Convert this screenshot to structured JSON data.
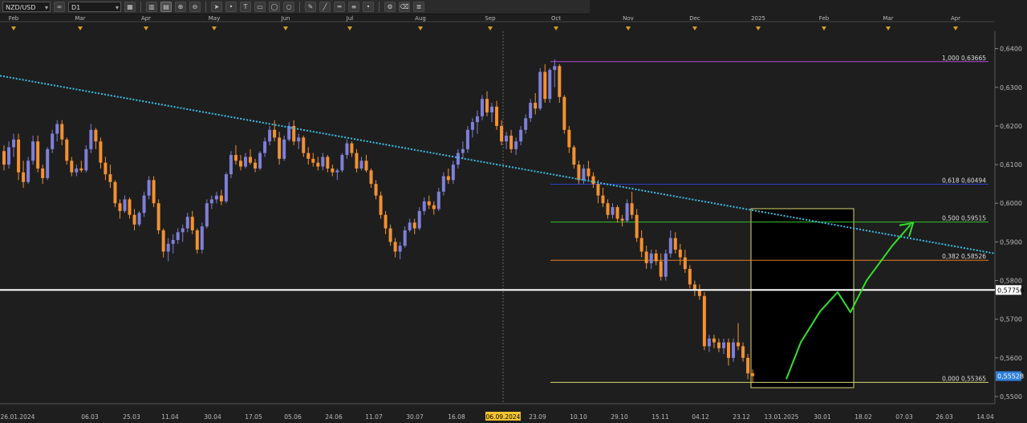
{
  "toolbar": {
    "symbol": "NZD/USD",
    "link": "∞",
    "timeframe": "D1",
    "buttons": [
      "chart-type-icon",
      "bar-chart-icon",
      "candle-chart-icon",
      "zoom-in-icon",
      "zoom-out-icon",
      "cursor-icon",
      "dot-icon",
      "text-icon",
      "rectangle-icon",
      "ellipse-icon",
      "circle-icon",
      "pencil-icon",
      "line-icon",
      "channel-icon",
      "fibonacci-icon",
      "dot-tool-icon",
      "gear-icon",
      "eraser-icon",
      "layers-icon"
    ]
  },
  "colors": {
    "bg": "#1e1e1e",
    "bull": "#7f7fd9",
    "bear": "#f39131",
    "trend": "#3cc0e8",
    "box": "#d8d870",
    "green_path": "#33e02a"
  },
  "chart_data": {
    "type": "candlestick",
    "symbol": "NZD/USD",
    "timeframe": "D1",
    "ylim": [
      0.55,
      0.642
    ],
    "y_ticks": [
      "0,6400",
      "0,6300",
      "0,6200",
      "0,6100",
      "0,6000",
      "0,5900",
      "0,5800",
      "0,5700",
      "0,5600",
      "0,5500"
    ],
    "month_labels": [
      "Feb",
      "Mar",
      "Apr",
      "May",
      "Jun",
      "Jul",
      "Aug",
      "Sep",
      "Oct",
      "Nov",
      "Dec",
      "2025",
      "Feb",
      "Mar",
      "Apr"
    ],
    "date_labels": [
      "26.01.2024",
      "06.03",
      "25.03",
      "11.04",
      "30.04",
      "17.05",
      "05.06",
      "24.06",
      "11.07",
      "30.07",
      "16.08",
      "06.09.2024",
      "23.09",
      "10.10",
      "29.10",
      "15.11",
      "04.12",
      "23.12",
      "13.01.2025",
      "30.01",
      "18.02",
      "07.03",
      "26.03",
      "14.04"
    ],
    "highlighted_date": "06.09.2024",
    "fibonacci": [
      {
        "label": "1,000 0,63665",
        "value": 0.63665,
        "color": "#b04ad8"
      },
      {
        "label": "0,618 0,60494",
        "value": 0.60494,
        "color": "#2d3fc8"
      },
      {
        "label": "0,500 0,59515",
        "value": 0.59515,
        "color": "#36c02e"
      },
      {
        "label": "0,382 0,58526",
        "value": 0.58526,
        "color": "#e07c26"
      },
      {
        "label": "0,000 0,55365",
        "value": 0.55365,
        "color": "#d8d870"
      }
    ],
    "horizontal_level": {
      "label": "0,57756",
      "value": 0.57756
    },
    "current_price": {
      "label": "0,55528",
      "value": 0.55528
    },
    "trendline": {
      "from": 0.633,
      "to": 0.587
    },
    "projection": [
      0.5545,
      0.564,
      0.572,
      0.577,
      0.5718,
      0.58,
      0.589,
      0.5945
    ],
    "candles": [
      [
        0.6135,
        0.615,
        0.6085,
        0.61
      ],
      [
        0.61,
        0.616,
        0.609,
        0.6145
      ],
      [
        0.6145,
        0.618,
        0.612,
        0.6165
      ],
      [
        0.6165,
        0.618,
        0.606,
        0.608
      ],
      [
        0.608,
        0.611,
        0.604,
        0.6055
      ],
      [
        0.6055,
        0.612,
        0.605,
        0.611
      ],
      [
        0.611,
        0.6175,
        0.61,
        0.616
      ],
      [
        0.616,
        0.6175,
        0.608,
        0.609
      ],
      [
        0.609,
        0.61,
        0.605,
        0.6065
      ],
      [
        0.6065,
        0.6145,
        0.606,
        0.614
      ],
      [
        0.614,
        0.619,
        0.613,
        0.618
      ],
      [
        0.618,
        0.6215,
        0.616,
        0.6205
      ],
      [
        0.6205,
        0.6215,
        0.615,
        0.6165
      ],
      [
        0.6165,
        0.617,
        0.61,
        0.611
      ],
      [
        0.611,
        0.612,
        0.607,
        0.608
      ],
      [
        0.608,
        0.61,
        0.607,
        0.609
      ],
      [
        0.609,
        0.611,
        0.608,
        0.6085
      ],
      [
        0.6085,
        0.615,
        0.608,
        0.614
      ],
      [
        0.614,
        0.6205,
        0.613,
        0.619
      ],
      [
        0.619,
        0.6195,
        0.614,
        0.616
      ],
      [
        0.616,
        0.617,
        0.609,
        0.6105
      ],
      [
        0.6105,
        0.612,
        0.606,
        0.6075
      ],
      [
        0.6075,
        0.61,
        0.604,
        0.6055
      ],
      [
        0.6055,
        0.606,
        0.599,
        0.6
      ],
      [
        0.6,
        0.601,
        0.596,
        0.598
      ],
      [
        0.598,
        0.602,
        0.5975,
        0.601
      ],
      [
        0.601,
        0.6015,
        0.596,
        0.597
      ],
      [
        0.597,
        0.5985,
        0.593,
        0.5945
      ],
      [
        0.5945,
        0.598,
        0.594,
        0.5975
      ],
      [
        0.5975,
        0.603,
        0.5965,
        0.602
      ],
      [
        0.602,
        0.607,
        0.601,
        0.606
      ],
      [
        0.606,
        0.607,
        0.599,
        0.6
      ],
      [
        0.6,
        0.601,
        0.592,
        0.593
      ],
      [
        0.593,
        0.5935,
        0.586,
        0.5875
      ],
      [
        0.5875,
        0.591,
        0.585,
        0.5895
      ],
      [
        0.5895,
        0.592,
        0.587,
        0.5905
      ],
      [
        0.5905,
        0.5935,
        0.5895,
        0.5925
      ],
      [
        0.5925,
        0.5945,
        0.59,
        0.5935
      ],
      [
        0.5935,
        0.5975,
        0.5925,
        0.5965
      ],
      [
        0.5965,
        0.598,
        0.592,
        0.593
      ],
      [
        0.593,
        0.5935,
        0.587,
        0.588
      ],
      [
        0.588,
        0.595,
        0.587,
        0.594
      ],
      [
        0.594,
        0.601,
        0.5935,
        0.6
      ],
      [
        0.6,
        0.602,
        0.5985,
        0.601
      ],
      [
        0.601,
        0.603,
        0.6,
        0.602
      ],
      [
        0.602,
        0.6035,
        0.5995,
        0.6005
      ],
      [
        0.6005,
        0.608,
        0.6,
        0.6075
      ],
      [
        0.6075,
        0.6135,
        0.6065,
        0.6125
      ],
      [
        0.6125,
        0.615,
        0.61,
        0.611
      ],
      [
        0.611,
        0.6125,
        0.6085,
        0.6095
      ],
      [
        0.6095,
        0.613,
        0.609,
        0.612
      ],
      [
        0.612,
        0.614,
        0.61,
        0.6105
      ],
      [
        0.6105,
        0.6115,
        0.608,
        0.609
      ],
      [
        0.609,
        0.6135,
        0.6085,
        0.613
      ],
      [
        0.613,
        0.617,
        0.612,
        0.616
      ],
      [
        0.616,
        0.62,
        0.615,
        0.619
      ],
      [
        0.619,
        0.6215,
        0.616,
        0.617
      ],
      [
        0.617,
        0.6185,
        0.61,
        0.6115
      ],
      [
        0.6115,
        0.6175,
        0.611,
        0.6165
      ],
      [
        0.6165,
        0.621,
        0.616,
        0.62
      ],
      [
        0.62,
        0.6215,
        0.615,
        0.616
      ],
      [
        0.616,
        0.618,
        0.614,
        0.617
      ],
      [
        0.617,
        0.6175,
        0.612,
        0.613
      ],
      [
        0.613,
        0.6145,
        0.61,
        0.6115
      ],
      [
        0.6115,
        0.613,
        0.6095,
        0.6105
      ],
      [
        0.6105,
        0.612,
        0.6085,
        0.6095
      ],
      [
        0.6095,
        0.613,
        0.6085,
        0.612
      ],
      [
        0.612,
        0.6125,
        0.608,
        0.609
      ],
      [
        0.609,
        0.61,
        0.607,
        0.608
      ],
      [
        0.608,
        0.609,
        0.606,
        0.6085
      ],
      [
        0.6085,
        0.613,
        0.608,
        0.6125
      ],
      [
        0.6125,
        0.6165,
        0.6115,
        0.6155
      ],
      [
        0.6155,
        0.616,
        0.612,
        0.613
      ],
      [
        0.613,
        0.614,
        0.608,
        0.609
      ],
      [
        0.609,
        0.612,
        0.6085,
        0.611
      ],
      [
        0.611,
        0.6125,
        0.608,
        0.6085
      ],
      [
        0.6085,
        0.609,
        0.604,
        0.605
      ],
      [
        0.605,
        0.606,
        0.601,
        0.602
      ],
      [
        0.602,
        0.603,
        0.596,
        0.597
      ],
      [
        0.597,
        0.598,
        0.592,
        0.5935
      ],
      [
        0.5935,
        0.5945,
        0.589,
        0.59
      ],
      [
        0.59,
        0.591,
        0.586,
        0.5875
      ],
      [
        0.5875,
        0.59,
        0.5855,
        0.589
      ],
      [
        0.589,
        0.594,
        0.5885,
        0.593
      ],
      [
        0.593,
        0.596,
        0.5925,
        0.595
      ],
      [
        0.595,
        0.596,
        0.592,
        0.5935
      ],
      [
        0.5935,
        0.599,
        0.593,
        0.598
      ],
      [
        0.598,
        0.6015,
        0.597,
        0.6005
      ],
      [
        0.6005,
        0.602,
        0.5985,
        0.5995
      ],
      [
        0.5995,
        0.6005,
        0.597,
        0.5985
      ],
      [
        0.5985,
        0.604,
        0.598,
        0.603
      ],
      [
        0.603,
        0.608,
        0.602,
        0.607
      ],
      [
        0.607,
        0.609,
        0.605,
        0.606
      ],
      [
        0.606,
        0.611,
        0.605,
        0.61
      ],
      [
        0.61,
        0.614,
        0.609,
        0.613
      ],
      [
        0.613,
        0.616,
        0.6115,
        0.614
      ],
      [
        0.614,
        0.62,
        0.613,
        0.619
      ],
      [
        0.619,
        0.622,
        0.617,
        0.621
      ],
      [
        0.621,
        0.624,
        0.618,
        0.6225
      ],
      [
        0.6225,
        0.628,
        0.6215,
        0.627
      ],
      [
        0.627,
        0.629,
        0.6225,
        0.6235
      ],
      [
        0.6235,
        0.626,
        0.621,
        0.625
      ],
      [
        0.625,
        0.6265,
        0.619,
        0.62
      ],
      [
        0.62,
        0.6215,
        0.615,
        0.616
      ],
      [
        0.616,
        0.6185,
        0.614,
        0.6175
      ],
      [
        0.6175,
        0.619,
        0.613,
        0.614
      ],
      [
        0.614,
        0.617,
        0.6125,
        0.616
      ],
      [
        0.616,
        0.62,
        0.615,
        0.619
      ],
      [
        0.619,
        0.623,
        0.618,
        0.622
      ],
      [
        0.622,
        0.627,
        0.621,
        0.626
      ],
      [
        0.626,
        0.6285,
        0.623,
        0.6245
      ],
      [
        0.6245,
        0.635,
        0.624,
        0.634
      ],
      [
        0.634,
        0.636,
        0.626,
        0.627
      ],
      [
        0.627,
        0.635,
        0.626,
        0.6345
      ],
      [
        0.6345,
        0.6372,
        0.63,
        0.6355
      ],
      [
        0.6355,
        0.636,
        0.626,
        0.6275
      ],
      [
        0.6275,
        0.628,
        0.618,
        0.619
      ],
      [
        0.619,
        0.62,
        0.613,
        0.6145
      ],
      [
        0.6145,
        0.615,
        0.609,
        0.61
      ],
      [
        0.61,
        0.611,
        0.605,
        0.606
      ],
      [
        0.606,
        0.61,
        0.605,
        0.609
      ],
      [
        0.609,
        0.611,
        0.606,
        0.607
      ],
      [
        0.607,
        0.608,
        0.604,
        0.605
      ],
      [
        0.605,
        0.606,
        0.6,
        0.602
      ],
      [
        0.602,
        0.604,
        0.599,
        0.6
      ],
      [
        0.6,
        0.601,
        0.596,
        0.597
      ],
      [
        0.597,
        0.6,
        0.596,
        0.599
      ],
      [
        0.599,
        0.5995,
        0.595,
        0.596
      ],
      [
        0.596,
        0.597,
        0.594,
        0.5955
      ],
      [
        0.5955,
        0.601,
        0.595,
        0.6
      ],
      [
        0.6,
        0.603,
        0.596,
        0.597
      ],
      [
        0.597,
        0.5985,
        0.59,
        0.591
      ],
      [
        0.591,
        0.593,
        0.586,
        0.5875
      ],
      [
        0.5875,
        0.589,
        0.583,
        0.5845
      ],
      [
        0.5845,
        0.588,
        0.583,
        0.587
      ],
      [
        0.587,
        0.588,
        0.584,
        0.585
      ],
      [
        0.585,
        0.587,
        0.58,
        0.581
      ],
      [
        0.581,
        0.588,
        0.58,
        0.587
      ],
      [
        0.587,
        0.593,
        0.586,
        0.591
      ],
      [
        0.591,
        0.5925,
        0.587,
        0.588
      ],
      [
        0.588,
        0.5895,
        0.584,
        0.586
      ],
      [
        0.586,
        0.588,
        0.582,
        0.583
      ],
      [
        0.583,
        0.584,
        0.578,
        0.579
      ],
      [
        0.579,
        0.58,
        0.576,
        0.5775
      ],
      [
        0.5775,
        0.579,
        0.575,
        0.576
      ],
      [
        0.576,
        0.577,
        0.562,
        0.563
      ],
      [
        0.563,
        0.566,
        0.5615,
        0.565
      ],
      [
        0.565,
        0.566,
        0.5625,
        0.564
      ],
      [
        0.564,
        0.565,
        0.5615,
        0.5625
      ],
      [
        0.5625,
        0.565,
        0.561,
        0.564
      ],
      [
        0.564,
        0.565,
        0.558,
        0.56
      ],
      [
        0.56,
        0.565,
        0.559,
        0.564
      ],
      [
        0.564,
        0.569,
        0.562,
        0.563
      ],
      [
        0.563,
        0.564,
        0.559,
        0.56
      ],
      [
        0.56,
        0.561,
        0.5545,
        0.556
      ],
      [
        0.556,
        0.557,
        0.5537,
        0.5553
      ]
    ]
  }
}
